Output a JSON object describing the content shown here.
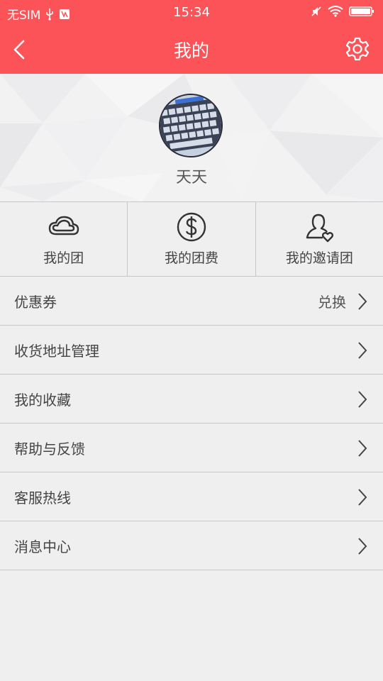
{
  "status_bar": {
    "carrier": "无SIM",
    "time": "15:34"
  },
  "nav": {
    "title": "我的",
    "back_icon": "back-arrow-icon",
    "settings_icon": "gear-icon"
  },
  "profile": {
    "username": "天天",
    "avatar_desc": "avatar"
  },
  "quick_actions": [
    {
      "label": "我的团",
      "icon": "cloud-icon"
    },
    {
      "label": "我的团费",
      "icon": "dollar-icon"
    },
    {
      "label": "我的邀请团",
      "icon": "user-heart-icon"
    }
  ],
  "menu": [
    {
      "label": "优惠券",
      "extra": "兑换"
    },
    {
      "label": "收货地址管理",
      "extra": ""
    },
    {
      "label": "我的收藏",
      "extra": ""
    },
    {
      "label": "帮助与反馈",
      "extra": ""
    },
    {
      "label": "客服热线",
      "extra": ""
    },
    {
      "label": "消息中心",
      "extra": ""
    }
  ],
  "colors": {
    "brand": "#fb5357",
    "background": "#efefef",
    "divider": "#c8c8c8"
  }
}
